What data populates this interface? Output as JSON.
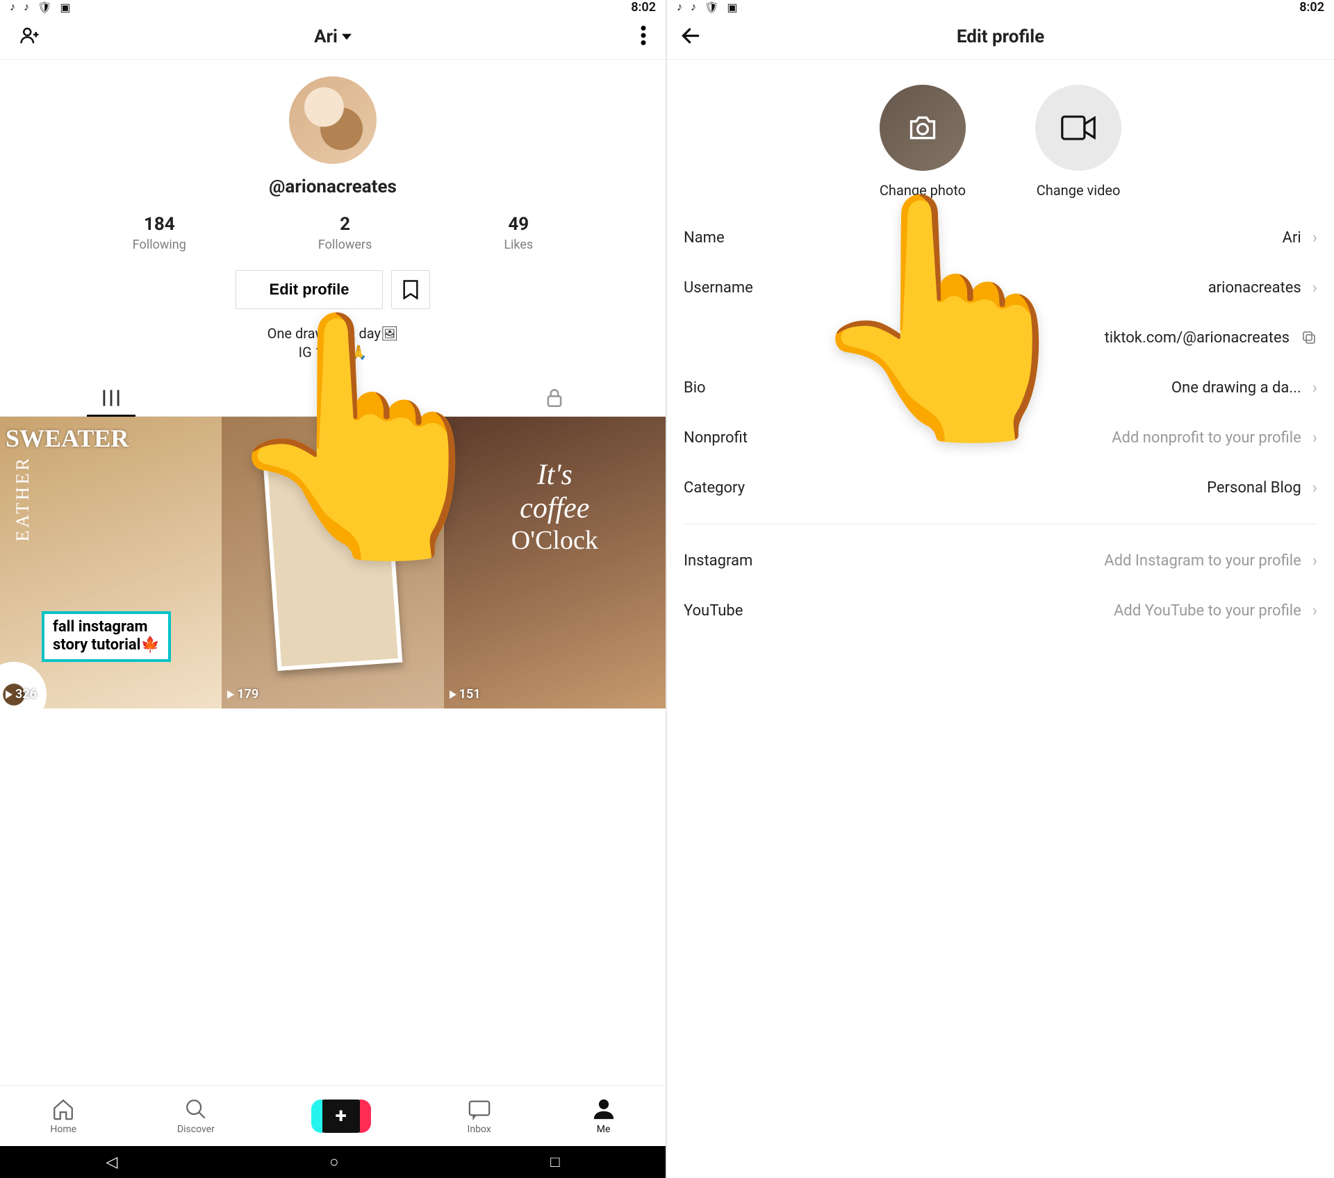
{
  "statusbar": {
    "time": "8:02"
  },
  "left": {
    "header_name": "Ari",
    "username": "@arionacreates",
    "following": {
      "count": "184",
      "label": "Following"
    },
    "followers": {
      "count": "2",
      "label": "Followers"
    },
    "likes": {
      "count": "49",
      "label": "Likes"
    },
    "edit_button": "Edit profile",
    "bio_line1": "One drawing a day🖼",
    "bio_line2": "IG 10:31🙏",
    "grid": [
      {
        "title": "SWEATER",
        "vertical": "EATHER",
        "cta_l1": "fall instagram",
        "cta_l2": "story tutorial🍁",
        "plays": "326"
      },
      {
        "plays": "179"
      },
      {
        "line1": "It's coffee",
        "line2": "O'Clock",
        "plays": "151"
      }
    ],
    "tabbar": {
      "home": "Home",
      "discover": "Discover",
      "inbox": "Inbox",
      "me": "Me"
    }
  },
  "right": {
    "title": "Edit profile",
    "change_photo": "Change photo",
    "change_video": "Change video",
    "rows": {
      "name": {
        "label": "Name",
        "value": "Ari"
      },
      "username": {
        "label": "Username",
        "value": "arionacreates"
      },
      "link": {
        "value": "tiktok.com/@arionacreates"
      },
      "bio": {
        "label": "Bio",
        "value": "One drawing a da..."
      },
      "nonprofit": {
        "label": "Nonprofit",
        "value": "Add nonprofit to your profile"
      },
      "category": {
        "label": "Category",
        "value": "Personal Blog"
      },
      "instagram": {
        "label": "Instagram",
        "value": "Add Instagram to your profile"
      },
      "youtube": {
        "label": "YouTube",
        "value": "Add YouTube to your profile"
      }
    }
  }
}
